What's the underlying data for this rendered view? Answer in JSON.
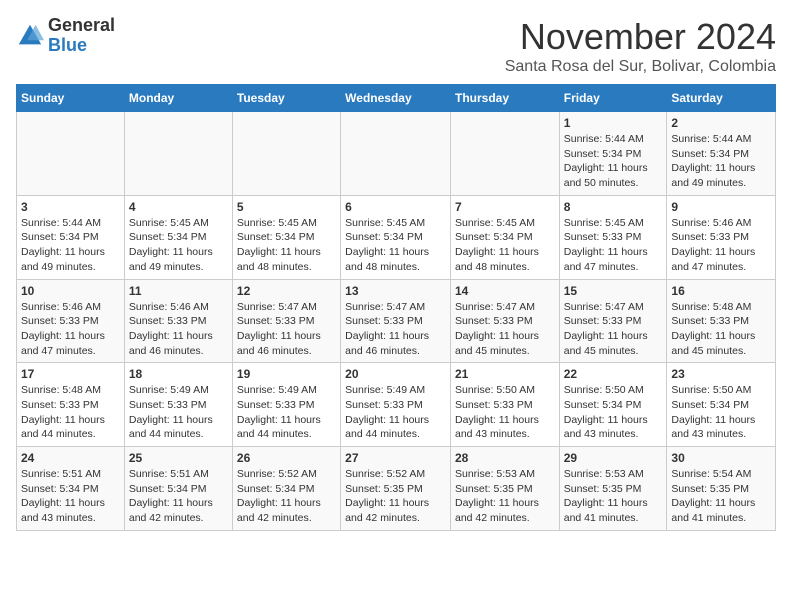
{
  "header": {
    "logo_general": "General",
    "logo_blue": "Blue",
    "month_title": "November 2024",
    "location": "Santa Rosa del Sur, Bolivar, Colombia"
  },
  "weekdays": [
    "Sunday",
    "Monday",
    "Tuesday",
    "Wednesday",
    "Thursday",
    "Friday",
    "Saturday"
  ],
  "weeks": [
    [
      {
        "day": "",
        "info": ""
      },
      {
        "day": "",
        "info": ""
      },
      {
        "day": "",
        "info": ""
      },
      {
        "day": "",
        "info": ""
      },
      {
        "day": "",
        "info": ""
      },
      {
        "day": "1",
        "info": "Sunrise: 5:44 AM\nSunset: 5:34 PM\nDaylight: 11 hours\nand 50 minutes."
      },
      {
        "day": "2",
        "info": "Sunrise: 5:44 AM\nSunset: 5:34 PM\nDaylight: 11 hours\nand 49 minutes."
      }
    ],
    [
      {
        "day": "3",
        "info": "Sunrise: 5:44 AM\nSunset: 5:34 PM\nDaylight: 11 hours\nand 49 minutes."
      },
      {
        "day": "4",
        "info": "Sunrise: 5:45 AM\nSunset: 5:34 PM\nDaylight: 11 hours\nand 49 minutes."
      },
      {
        "day": "5",
        "info": "Sunrise: 5:45 AM\nSunset: 5:34 PM\nDaylight: 11 hours\nand 48 minutes."
      },
      {
        "day": "6",
        "info": "Sunrise: 5:45 AM\nSunset: 5:34 PM\nDaylight: 11 hours\nand 48 minutes."
      },
      {
        "day": "7",
        "info": "Sunrise: 5:45 AM\nSunset: 5:34 PM\nDaylight: 11 hours\nand 48 minutes."
      },
      {
        "day": "8",
        "info": "Sunrise: 5:45 AM\nSunset: 5:33 PM\nDaylight: 11 hours\nand 47 minutes."
      },
      {
        "day": "9",
        "info": "Sunrise: 5:46 AM\nSunset: 5:33 PM\nDaylight: 11 hours\nand 47 minutes."
      }
    ],
    [
      {
        "day": "10",
        "info": "Sunrise: 5:46 AM\nSunset: 5:33 PM\nDaylight: 11 hours\nand 47 minutes."
      },
      {
        "day": "11",
        "info": "Sunrise: 5:46 AM\nSunset: 5:33 PM\nDaylight: 11 hours\nand 46 minutes."
      },
      {
        "day": "12",
        "info": "Sunrise: 5:47 AM\nSunset: 5:33 PM\nDaylight: 11 hours\nand 46 minutes."
      },
      {
        "day": "13",
        "info": "Sunrise: 5:47 AM\nSunset: 5:33 PM\nDaylight: 11 hours\nand 46 minutes."
      },
      {
        "day": "14",
        "info": "Sunrise: 5:47 AM\nSunset: 5:33 PM\nDaylight: 11 hours\nand 45 minutes."
      },
      {
        "day": "15",
        "info": "Sunrise: 5:47 AM\nSunset: 5:33 PM\nDaylight: 11 hours\nand 45 minutes."
      },
      {
        "day": "16",
        "info": "Sunrise: 5:48 AM\nSunset: 5:33 PM\nDaylight: 11 hours\nand 45 minutes."
      }
    ],
    [
      {
        "day": "17",
        "info": "Sunrise: 5:48 AM\nSunset: 5:33 PM\nDaylight: 11 hours\nand 44 minutes."
      },
      {
        "day": "18",
        "info": "Sunrise: 5:49 AM\nSunset: 5:33 PM\nDaylight: 11 hours\nand 44 minutes."
      },
      {
        "day": "19",
        "info": "Sunrise: 5:49 AM\nSunset: 5:33 PM\nDaylight: 11 hours\nand 44 minutes."
      },
      {
        "day": "20",
        "info": "Sunrise: 5:49 AM\nSunset: 5:33 PM\nDaylight: 11 hours\nand 44 minutes."
      },
      {
        "day": "21",
        "info": "Sunrise: 5:50 AM\nSunset: 5:33 PM\nDaylight: 11 hours\nand 43 minutes."
      },
      {
        "day": "22",
        "info": "Sunrise: 5:50 AM\nSunset: 5:34 PM\nDaylight: 11 hours\nand 43 minutes."
      },
      {
        "day": "23",
        "info": "Sunrise: 5:50 AM\nSunset: 5:34 PM\nDaylight: 11 hours\nand 43 minutes."
      }
    ],
    [
      {
        "day": "24",
        "info": "Sunrise: 5:51 AM\nSunset: 5:34 PM\nDaylight: 11 hours\nand 43 minutes."
      },
      {
        "day": "25",
        "info": "Sunrise: 5:51 AM\nSunset: 5:34 PM\nDaylight: 11 hours\nand 42 minutes."
      },
      {
        "day": "26",
        "info": "Sunrise: 5:52 AM\nSunset: 5:34 PM\nDaylight: 11 hours\nand 42 minutes."
      },
      {
        "day": "27",
        "info": "Sunrise: 5:52 AM\nSunset: 5:35 PM\nDaylight: 11 hours\nand 42 minutes."
      },
      {
        "day": "28",
        "info": "Sunrise: 5:53 AM\nSunset: 5:35 PM\nDaylight: 11 hours\nand 42 minutes."
      },
      {
        "day": "29",
        "info": "Sunrise: 5:53 AM\nSunset: 5:35 PM\nDaylight: 11 hours\nand 41 minutes."
      },
      {
        "day": "30",
        "info": "Sunrise: 5:54 AM\nSunset: 5:35 PM\nDaylight: 11 hours\nand 41 minutes."
      }
    ]
  ]
}
